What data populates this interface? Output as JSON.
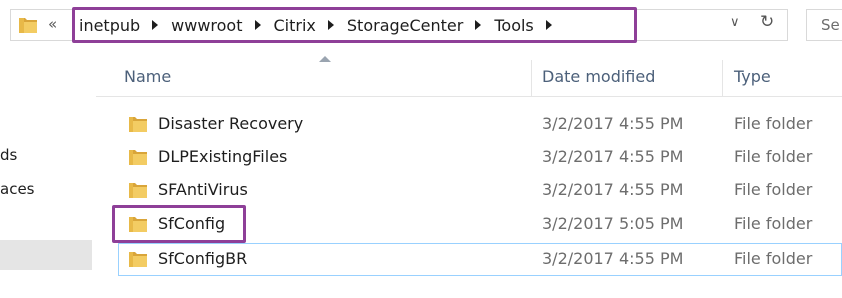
{
  "address": {
    "back_chevron": "«",
    "crumbs": [
      "inetpub",
      "wwwroot",
      "Citrix",
      "StorageCenter",
      "Tools"
    ],
    "dropdown_icon": "chevron-down-icon",
    "refresh_icon": "refresh-icon",
    "search_placeholder": "Se"
  },
  "nav": {
    "items": [
      "ds",
      "aces"
    ]
  },
  "columns": {
    "name": "Name",
    "date": "Date modified",
    "type": "Type"
  },
  "rows": [
    {
      "name": "Disaster Recovery",
      "date": "3/2/2017 4:55 PM",
      "type": "File folder"
    },
    {
      "name": "DLPExistingFiles",
      "date": "3/2/2017 4:55 PM",
      "type": "File folder"
    },
    {
      "name": "SFAntiVirus",
      "date": "3/2/2017 4:55 PM",
      "type": "File folder"
    },
    {
      "name": "SfConfig",
      "date": "3/2/2017 5:05 PM",
      "type": "File folder"
    },
    {
      "name": "SfConfigBR",
      "date": "3/2/2017 4:55 PM",
      "type": "File folder"
    }
  ],
  "colors": {
    "highlight": "#8e3f98",
    "folder": "#e8b948"
  }
}
